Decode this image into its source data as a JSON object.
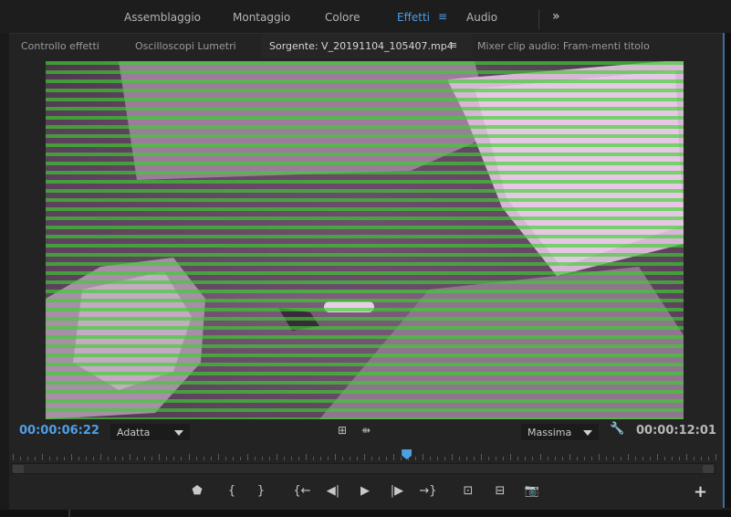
{
  "workspace": {
    "tabs": [
      {
        "label": "Assemblaggio",
        "active": false
      },
      {
        "label": "Montaggio",
        "active": false
      },
      {
        "label": "Colore",
        "active": false
      },
      {
        "label": "Effetti",
        "active": true
      },
      {
        "label": "Audio",
        "active": false
      }
    ],
    "menu_icon": "hamburger-icon",
    "more_icon": "chevron-double-right-icon",
    "more_glyph": "»",
    "menu_glyph": "≡"
  },
  "panel": {
    "tabs": [
      {
        "label": "Controllo effetti",
        "active": false
      },
      {
        "label": "Oscilloscopi Lumetri",
        "active": false
      },
      {
        "label": "Sorgente: V_20191104_105407.mp4",
        "active": true
      },
      {
        "label": "Mixer clip audio: Fram-menti titolo",
        "active": false
      }
    ],
    "menu_glyph": "≡"
  },
  "monitor": {
    "current_timecode": "00:00:06:22",
    "duration_timecode": "00:00:12:01",
    "fit_value": "Adatta",
    "quality_value": "Massima",
    "playhead_position": 0.56,
    "accent_color": "#4f9fe6",
    "icons": {
      "export_frame_glyph": "▦",
      "settings_glyph": "🔧",
      "drag_video_glyph": "⊞",
      "drag_audio_glyph": "⇻"
    }
  },
  "transport": {
    "mark_glyph": "⬟",
    "in_glyph": "{",
    "out_glyph": "}",
    "goto_in_glyph": "{←",
    "step_back_glyph": "◀|",
    "play_glyph": "▶",
    "step_fwd_glyph": "|▶",
    "goto_out_glyph": "→}",
    "insert_glyph": "⊡",
    "overwrite_glyph": "⊟",
    "export_glyph": "📷",
    "add_glyph": "+"
  }
}
